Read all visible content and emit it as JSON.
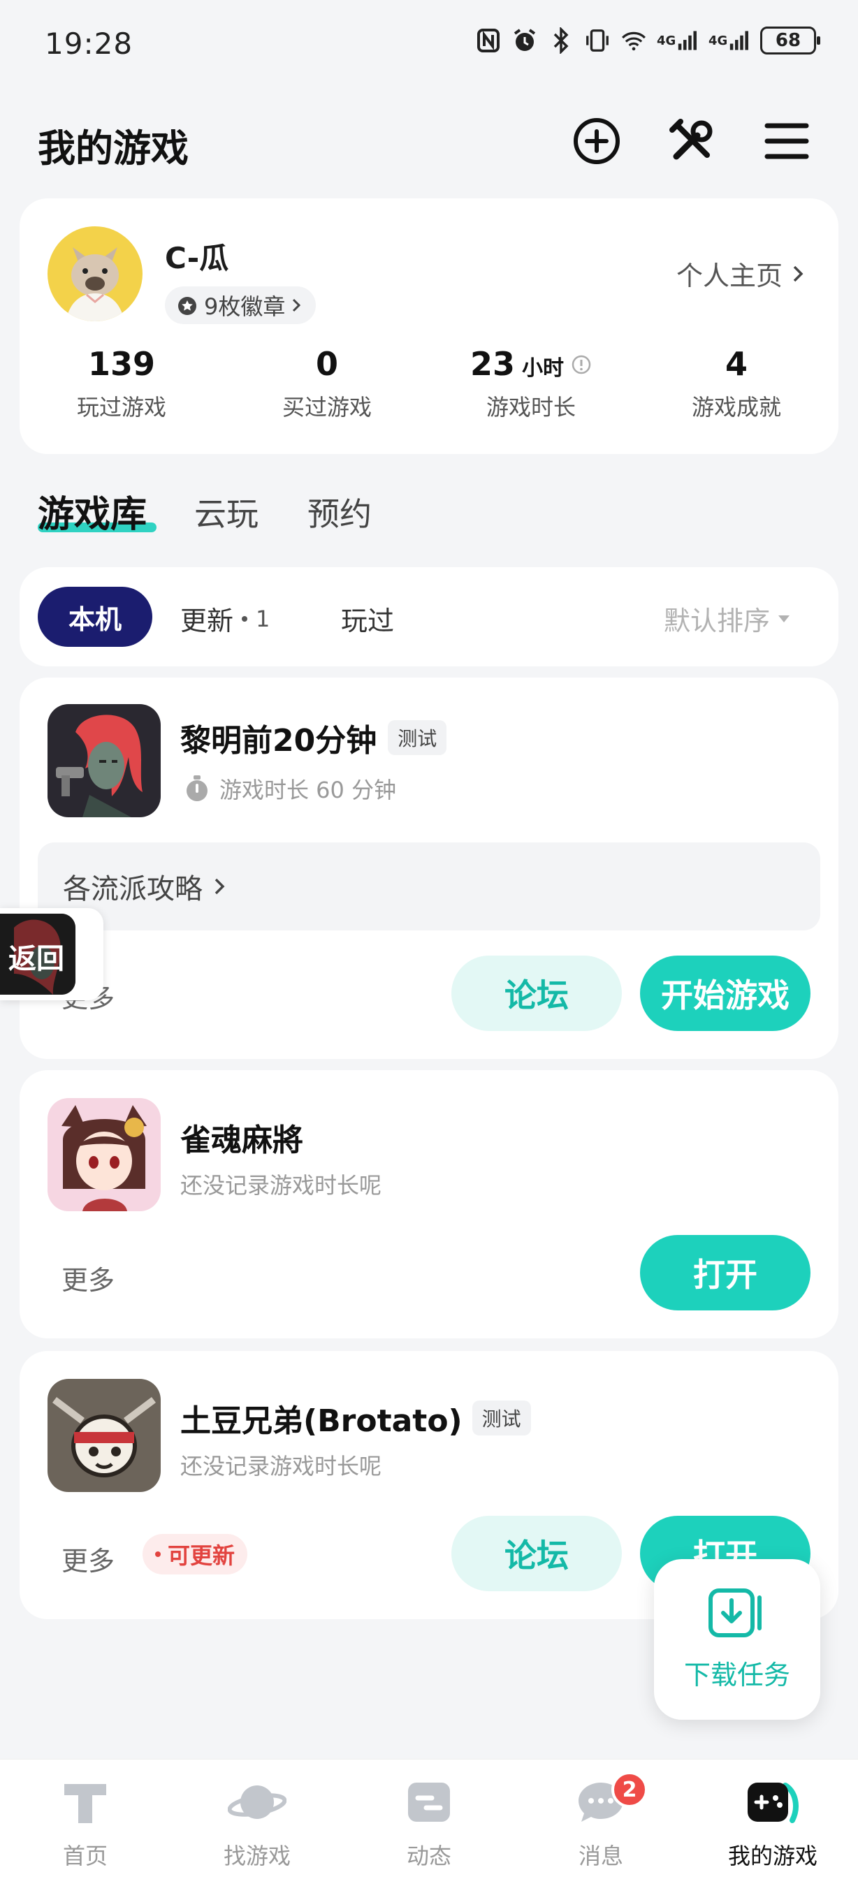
{
  "status_bar": {
    "time": "19:28",
    "battery": "68",
    "network_1": "4G",
    "network_2": "4G"
  },
  "header": {
    "title": "我的游戏"
  },
  "profile": {
    "username": "C-瓜",
    "badges": "9枚徽章",
    "home_link": "个人主页",
    "stats": [
      {
        "value": "139",
        "unit": "",
        "label": "玩过游戏"
      },
      {
        "value": "0",
        "unit": "",
        "label": "买过游戏"
      },
      {
        "value": "23",
        "unit": "小时",
        "label": "游戏时长"
      },
      {
        "value": "4",
        "unit": "",
        "label": "游戏成就"
      }
    ]
  },
  "tabs": [
    {
      "label": "游戏库"
    },
    {
      "label": "云玩"
    },
    {
      "label": "预约"
    }
  ],
  "filters": {
    "local": "本机",
    "update": "更新",
    "update_count": "1",
    "played": "玩过",
    "sort": "默认排序"
  },
  "games": [
    {
      "name": "黎明前20分钟",
      "tag": "测试",
      "sub": "游戏时长 60 分钟",
      "guide": "各流派攻略",
      "more": "更多",
      "btn_forum": "论坛",
      "btn_main": "开始游戏"
    },
    {
      "name": "雀魂麻將",
      "sub": "还没记录游戏时长呢",
      "more": "更多",
      "btn_main": "打开"
    },
    {
      "name": "土豆兄弟(Brotato)",
      "tag": "测试",
      "sub": "还没记录游戏时长呢",
      "more": "更多",
      "update_tag": "可更新",
      "btn_forum": "论坛",
      "btn_main": "打开"
    }
  ],
  "back_float": {
    "label": "返回"
  },
  "download_float": {
    "label": "下载任务"
  },
  "bottom_nav": [
    {
      "label": "首页",
      "icon": "home-icon"
    },
    {
      "label": "找游戏",
      "icon": "planet-icon"
    },
    {
      "label": "动态",
      "icon": "feed-icon"
    },
    {
      "label": "消息",
      "icon": "chat-icon",
      "badge": "2"
    },
    {
      "label": "我的游戏",
      "icon": "gamepad-icon"
    }
  ],
  "colors": {
    "accent": "#1dd1bc",
    "filter_active": "#1b1d6f",
    "badge_red": "#ef4b47"
  }
}
